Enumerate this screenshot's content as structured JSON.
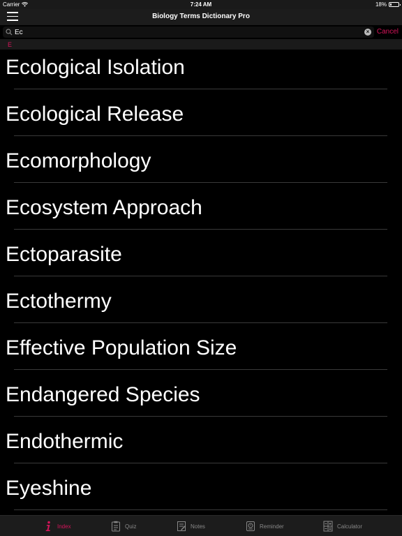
{
  "status_bar": {
    "carrier": "Carrier",
    "time": "7:24 AM",
    "battery": "18%",
    "battery_level": 0.18
  },
  "nav": {
    "title": "Biology Terms Dictionary Pro"
  },
  "search": {
    "value": "Ec",
    "cancel_label": "Cancel"
  },
  "section": {
    "letter": "E"
  },
  "terms": [
    "Ecological Isolation",
    "Ecological Release",
    "Ecomorphology",
    "Ecosystem Approach",
    "Ectoparasite",
    "Ectothermy",
    "Effective Population Size",
    "Endangered Species",
    "Endothermic",
    "Eyeshine"
  ],
  "tabs": [
    {
      "label": "Index",
      "icon": "info-icon",
      "active": true
    },
    {
      "label": "Quiz",
      "icon": "quiz-icon"
    },
    {
      "label": "Notes",
      "icon": "notes-icon"
    },
    {
      "label": "Reminder",
      "icon": "reminder-icon"
    },
    {
      "label": "Calculator",
      "icon": "calculator-icon"
    }
  ],
  "colors": {
    "accent": "#d4145a",
    "background": "#000000"
  }
}
